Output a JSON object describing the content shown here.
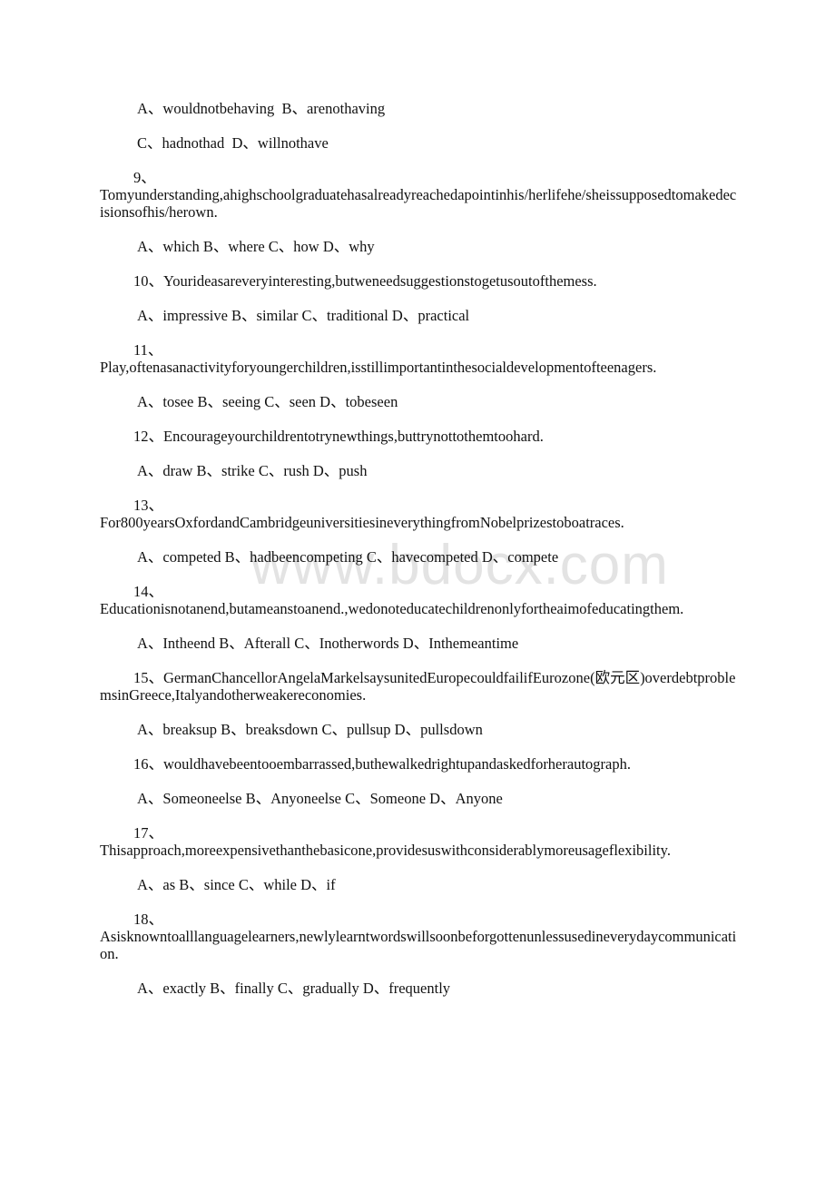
{
  "watermark": "www.bdocx.com",
  "blocks": [
    {
      "type": "options",
      "text": "A、wouldnotbehaving  B、arenothaving"
    },
    {
      "type": "options",
      "text": "C、hadnothad  D、willnothave"
    },
    {
      "type": "question_wrapped",
      "number": "9、",
      "text": "Tomyunderstanding,ahighschoolgraduatehasalreadyreachedapointinhis/herlifehe/sheissupposedtomakedecisionsofhis/herown."
    },
    {
      "type": "options",
      "text": "A、which B、where C、how D、why"
    },
    {
      "type": "question_inline",
      "number": "10、",
      "text": "Yourideasareveryinteresting,butweneedsuggestionstogetusoutofthemess."
    },
    {
      "type": "options",
      "text": "A、impressive B、similar C、traditional D、practical"
    },
    {
      "type": "question_wrapped",
      "number": "11、",
      "text": "Play,oftenasanactivityforyoungerchildren,isstillimportantinthesocialdevelopmentofteenagers."
    },
    {
      "type": "options",
      "text": "A、tosee B、seeing C、seen D、tobeseen"
    },
    {
      "type": "question_inline",
      "number": "12、",
      "text": "Encourageyourchildrentotrynewthings,buttrynottothemtoohard."
    },
    {
      "type": "options",
      "text": "A、draw B、strike C、rush D、push"
    },
    {
      "type": "question_wrapped",
      "number": "13、",
      "text": "For800yearsOxfordandCambridgeuniversitiesineverythingfromNobelprizestoboatraces."
    },
    {
      "type": "options",
      "text": "A、competed B、hadbeencompeting C、havecompeted D、compete"
    },
    {
      "type": "question_wrapped",
      "number": "14、",
      "text": "Educationisnotanend,butameanstoanend.,wedonoteducatechildrenonlyfortheaimofeducatingthem."
    },
    {
      "type": "options",
      "text": "A、Intheend B、Afterall C、Inotherwords D、Inthemeantime"
    },
    {
      "type": "question_indented",
      "number": "15、",
      "text": "GermanChancellorAngelaMarkelsaysunitedEuropecouldfailifEurozone(欧元区)overdebtproblemsinGreece,Italyandotherweakereconomies."
    },
    {
      "type": "options",
      "text": "A、breaksup B、breaksdown C、pullsup D、pullsdown"
    },
    {
      "type": "question_inline",
      "number": "16、",
      "text": "wouldhavebeentooembarrassed,buthewalkedrightupandaskedforherautograph."
    },
    {
      "type": "options",
      "text": "A、Someoneelse B、Anyoneelse C、Someone D、Anyone"
    },
    {
      "type": "question_wrapped",
      "number": "17、",
      "text": "Thisapproach,moreexpensivethanthebasicone,providesuswithconsiderablymoreusageflexibility."
    },
    {
      "type": "options",
      "text": "A、as B、since C、while D、if"
    },
    {
      "type": "question_wrapped",
      "number": "18、",
      "text": "Asisknowntoalllanguagelearners,newlylearntwordswillsoonbeforgottenunlessusedineverydaycommunication."
    },
    {
      "type": "options",
      "text": "A、exactly B、finally C、gradually D、frequently"
    }
  ]
}
